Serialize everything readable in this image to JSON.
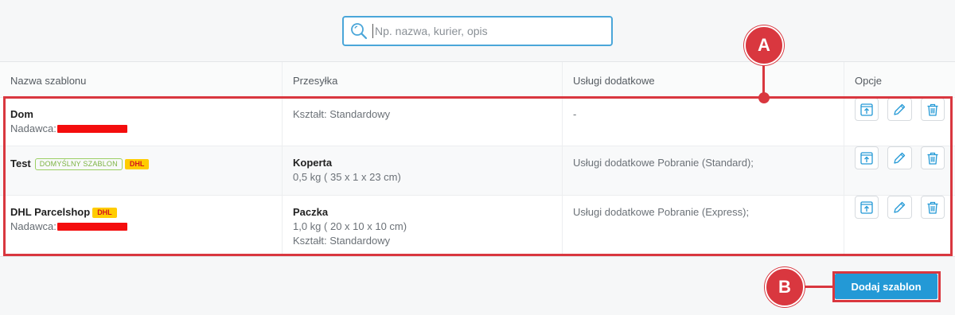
{
  "search": {
    "placeholder": "Np. nazwa, kurier, opis"
  },
  "table": {
    "headers": [
      "Nazwa szablonu",
      "Przesyłka",
      "Usługi dodatkowe",
      "Opcje"
    ],
    "rows": [
      {
        "name": "Dom",
        "sender_label": "Nadawca:",
        "shipment_line1": "Kształt: Standardowy",
        "services": "-"
      },
      {
        "name": "Test",
        "default_badge": "DOMYŚLNY SZABLON",
        "carrier_badge": "DHL",
        "shipment_type": "Koperta",
        "shipment_line1": "0,5 kg ( 35 x 1 x 23 cm)",
        "services": "Usługi dodatkowe Pobranie (Standard);"
      },
      {
        "name": "DHL Parcelshop",
        "carrier_badge": "DHL",
        "sender_label": "Nadawca:",
        "shipment_type": "Paczka",
        "shipment_line1": "1,0 kg ( 20 x 10 x 10 cm)",
        "shipment_line2": "Kształt: Standardowy",
        "services": "Usługi dodatkowe Pobranie (Express);"
      }
    ]
  },
  "actions": {
    "add_label": "Dodaj szablon"
  },
  "annotations": {
    "a": "A",
    "b": "B"
  },
  "icons": [
    "search-icon",
    "upload-icon",
    "pencil-icon",
    "trash-icon"
  ],
  "colors": {
    "accent": "#2399d6",
    "annotation": "#d9373f",
    "redaction": "#f40d0d",
    "dhl_yellow": "#ffcc00",
    "default_green": "#7cb342"
  }
}
